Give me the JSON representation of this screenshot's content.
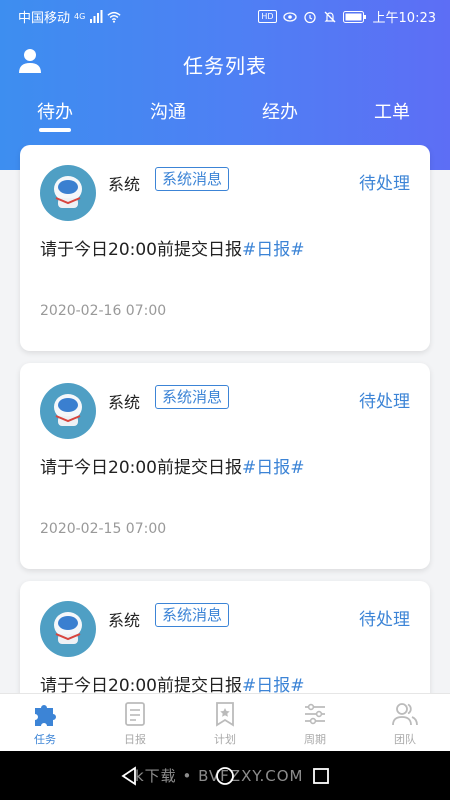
{
  "status_bar": {
    "carrier": "中国移动",
    "network": "4G",
    "hd": "HD",
    "time": "上午10:23"
  },
  "header": {
    "title": "任务列表"
  },
  "tabs": [
    {
      "label": "待办",
      "active": true
    },
    {
      "label": "沟通",
      "active": false
    },
    {
      "label": "经办",
      "active": false
    },
    {
      "label": "工单",
      "active": false
    }
  ],
  "cards": [
    {
      "sender": "系统",
      "badge": "系统消息",
      "status": "待处理",
      "message": "请于今日20:00前提交日报",
      "tag": "#日报#",
      "time": "2020-02-16 07:00"
    },
    {
      "sender": "系统",
      "badge": "系统消息",
      "status": "待处理",
      "message": "请于今日20:00前提交日报",
      "tag": "#日报#",
      "time": "2020-02-15 07:00"
    },
    {
      "sender": "系统",
      "badge": "系统消息",
      "status": "待处理",
      "message": "请于今日20:00前提交日报",
      "tag": "#日报#",
      "time": ""
    }
  ],
  "bottom_nav": [
    {
      "label": "任务",
      "icon": "puzzle-icon",
      "active": true
    },
    {
      "label": "日报",
      "icon": "document-icon",
      "active": false
    },
    {
      "label": "计划",
      "icon": "bookmark-star-icon",
      "active": false
    },
    {
      "label": "周期",
      "icon": "sliders-icon",
      "active": false
    },
    {
      "label": "团队",
      "icon": "team-icon",
      "active": false
    }
  ],
  "watermark": "k下载 • BVFZXY.COM",
  "colors": {
    "accent": "#3c84d6",
    "header_start": "#3d8ef0",
    "header_end": "#5d6ef5"
  }
}
